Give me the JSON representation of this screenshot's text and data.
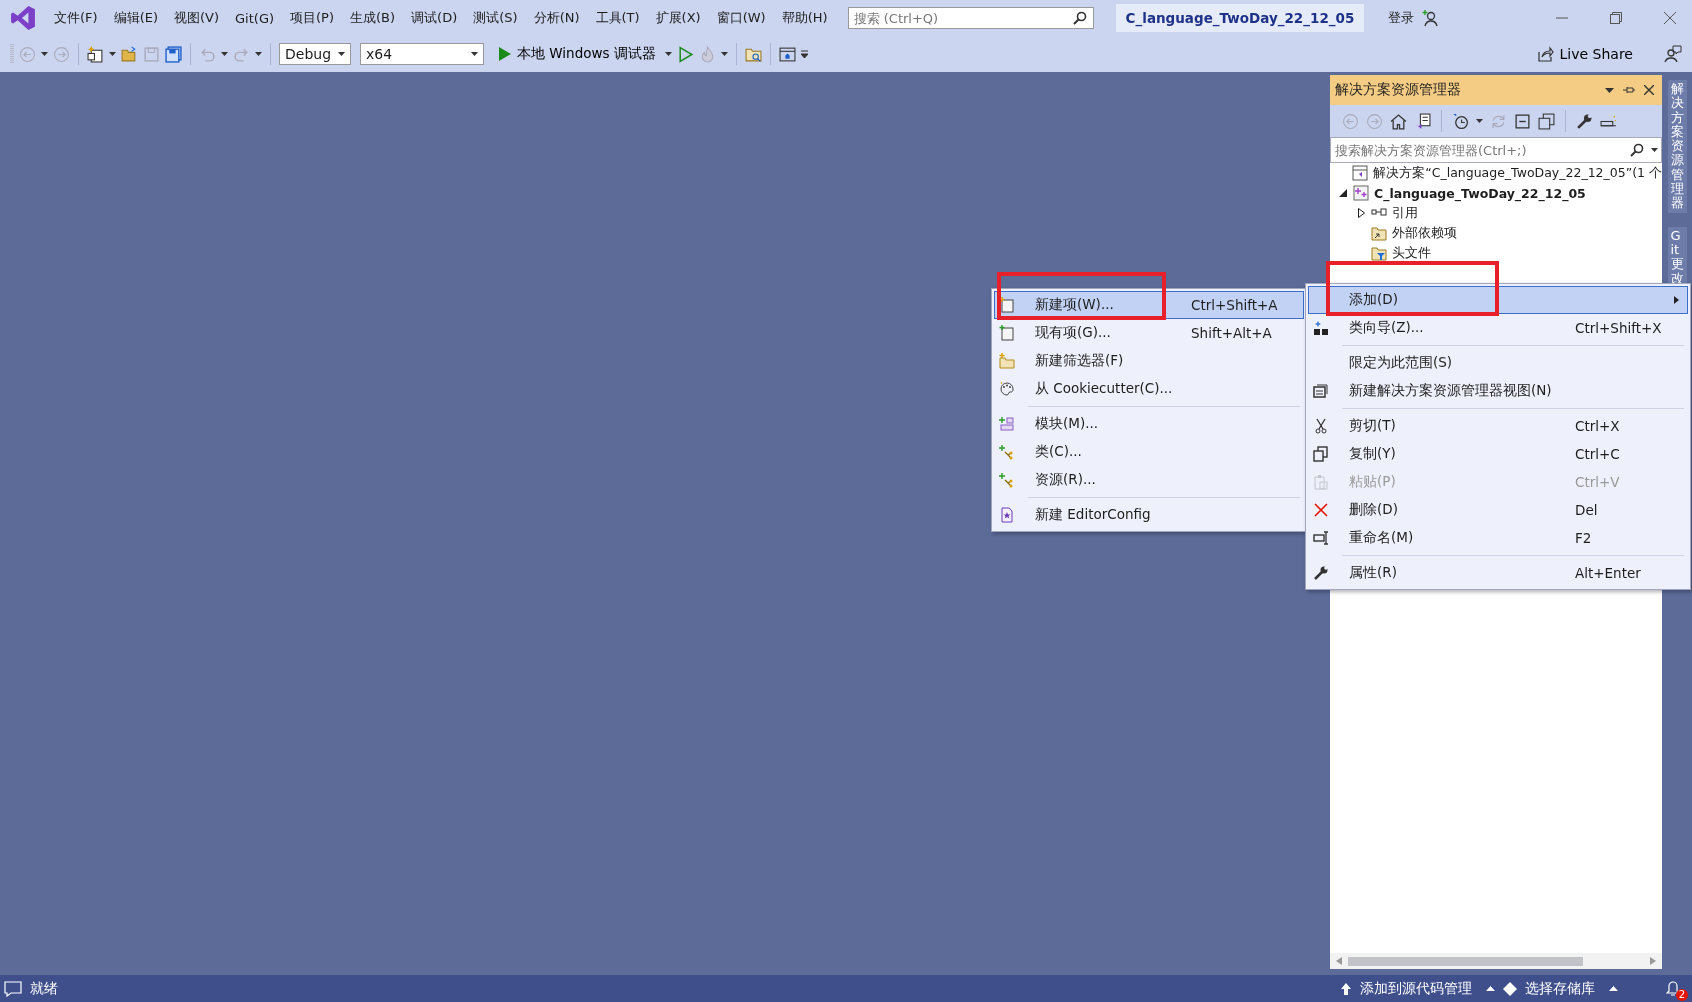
{
  "title_bar": {
    "menu": [
      "文件(F)",
      "编辑(E)",
      "视图(V)",
      "Git(G)",
      "项目(P)",
      "生成(B)",
      "调试(D)",
      "测试(S)",
      "分析(N)",
      "工具(T)",
      "扩展(X)",
      "窗口(W)",
      "帮助(H)"
    ],
    "search": {
      "placeholder": "搜索 (Ctrl+Q)"
    },
    "solution_name": "C_language_TwoDay_22_12_05",
    "sign_in": "登录"
  },
  "toolbar": {
    "configuration": "Debug",
    "platform": "x64",
    "debugger": "本地 Windows 调试器",
    "live_share": "Live Share"
  },
  "solution_explorer": {
    "title": "解决方案资源管理器",
    "search": {
      "placeholder": "搜索解决方案资源管理器(Ctrl+;)"
    },
    "tree": [
      {
        "label": "解决方案“C_language_TwoDay_22_12_05”(1 个",
        "kind": "solution",
        "children": [
          {
            "label": "C_language_TwoDay_22_12_05",
            "kind": "project",
            "expanded": true,
            "children": [
              {
                "label": "引用",
                "kind": "references",
                "expanded": false
              },
              {
                "label": "外部依赖项",
                "kind": "external"
              },
              {
                "label": "头文件",
                "kind": "filter"
              }
            ]
          }
        ]
      }
    ]
  },
  "side_tabs": [
    "解决方案资源管理器",
    "Git 更改"
  ],
  "context_menu": {
    "groups": [
      [
        {
          "label": "添加(D)",
          "kind": "add",
          "selected": true,
          "disabled": false,
          "submenu": true
        },
        {
          "label": "类向导(Z)...",
          "kind": "wizard",
          "shortcut": "Ctrl+Shift+X",
          "selected": false,
          "disabled": false,
          "submenu": false
        }
      ],
      [
        {
          "label": "限定为此范围(S)",
          "kind": "none",
          "selected": false,
          "disabled": false,
          "submenu": false
        },
        {
          "label": "新建解决方案资源管理器视图(N)",
          "kind": "view",
          "selected": false,
          "disabled": false,
          "submenu": false
        }
      ],
      [
        {
          "label": "剪切(T)",
          "kind": "cut",
          "shortcut": "Ctrl+X",
          "selected": false,
          "disabled": false,
          "submenu": false
        },
        {
          "label": "复制(Y)",
          "kind": "copy",
          "shortcut": "Ctrl+C",
          "selected": false,
          "disabled": false,
          "submenu": false
        },
        {
          "label": "粘贴(P)",
          "kind": "paste",
          "shortcut": "Ctrl+V",
          "selected": false,
          "disabled": true,
          "submenu": false
        },
        {
          "label": "删除(D)",
          "kind": "delete",
          "shortcut": "Del",
          "selected": false,
          "disabled": false,
          "submenu": false
        },
        {
          "label": "重命名(M)",
          "kind": "rename",
          "shortcut": "F2",
          "selected": false,
          "disabled": false,
          "submenu": false
        }
      ],
      [
        {
          "label": "属性(R)",
          "kind": "properties",
          "shortcut": "Alt+Enter",
          "selected": false,
          "disabled": false,
          "submenu": false
        }
      ]
    ]
  },
  "add_submenu": {
    "groups": [
      [
        {
          "label": "新建项(W)...",
          "kind": "new-item",
          "shortcut": "Ctrl+Shift+A",
          "selected": true,
          "disabled": false
        },
        {
          "label": "现有项(G)...",
          "kind": "existing-item",
          "shortcut": "Shift+Alt+A",
          "selected": false,
          "disabled": false
        },
        {
          "label": "新建筛选器(F)",
          "kind": "filter",
          "selected": false,
          "disabled": false
        },
        {
          "label": "从 Cookiecutter(C)...",
          "kind": "palette",
          "selected": false,
          "disabled": false
        }
      ],
      [
        {
          "label": "模块(M)...",
          "kind": "module",
          "selected": false,
          "disabled": false
        },
        {
          "label": "类(C)...",
          "kind": "class",
          "selected": false,
          "disabled": false
        },
        {
          "label": "资源(R)...",
          "kind": "class",
          "selected": false,
          "disabled": false
        }
      ],
      [
        {
          "label": "新建 EditorConfig",
          "kind": "config",
          "selected": false,
          "disabled": false
        }
      ]
    ]
  },
  "status_bar": {
    "status": "就绪",
    "source_control": "添加到源代码管理",
    "repository": "选择存储库",
    "notifications": "2"
  }
}
